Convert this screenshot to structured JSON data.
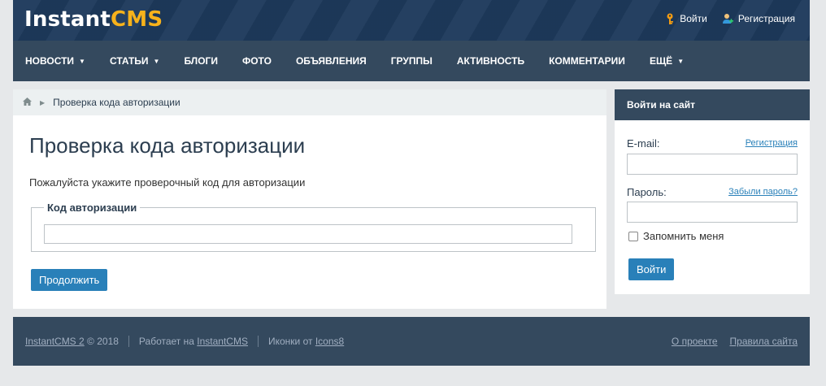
{
  "header": {
    "logo_part1": "Instant",
    "logo_part2": "CMS",
    "login_label": "Войти",
    "register_label": "Регистрация",
    "icons": {
      "login": "key-icon",
      "register": "user-add-icon"
    }
  },
  "nav": {
    "items": [
      {
        "label": "НОВОСТИ",
        "dropdown": true
      },
      {
        "label": "СТАТЬИ",
        "dropdown": true
      },
      {
        "label": "БЛОГИ",
        "dropdown": false
      },
      {
        "label": "ФОТО",
        "dropdown": false
      },
      {
        "label": "ОБЪЯВЛЕНИЯ",
        "dropdown": false
      },
      {
        "label": "ГРУППЫ",
        "dropdown": false
      },
      {
        "label": "АКТИВНОСТЬ",
        "dropdown": false
      },
      {
        "label": "КОММЕНТАРИИ",
        "dropdown": false
      },
      {
        "label": "ЕЩЁ",
        "dropdown": true
      }
    ]
  },
  "breadcrumb": {
    "current": "Проверка кода авторизации"
  },
  "main": {
    "title": "Проверка кода авторизации",
    "intro": "Пожалуйста укажите проверочный код для авторизации",
    "fieldset_legend": "Код авторизации",
    "code_value": "",
    "continue_label": "Продолжить"
  },
  "sidebar": {
    "title": "Войти на сайт",
    "email_label": "E-mail:",
    "register_link": "Регистрация",
    "password_label": "Пароль:",
    "forgot_link": "Забыли пароль?",
    "remember_label": "Запомнить меня",
    "remember_checked": false,
    "login_button": "Войти"
  },
  "footer": {
    "copyright_link": "InstantCMS 2",
    "copyright_year": "© 2018",
    "powered_text": "Работает на",
    "powered_link": "InstantCMS",
    "icons_text": "Иконки от",
    "icons_link": "Icons8",
    "about_link": "О проекте",
    "rules_link": "Правила сайта"
  },
  "colors": {
    "header_bg": "#1e3a5c",
    "nav_bg": "#34495e",
    "accent": "#2980b9",
    "logo_accent": "#f7b21b"
  }
}
